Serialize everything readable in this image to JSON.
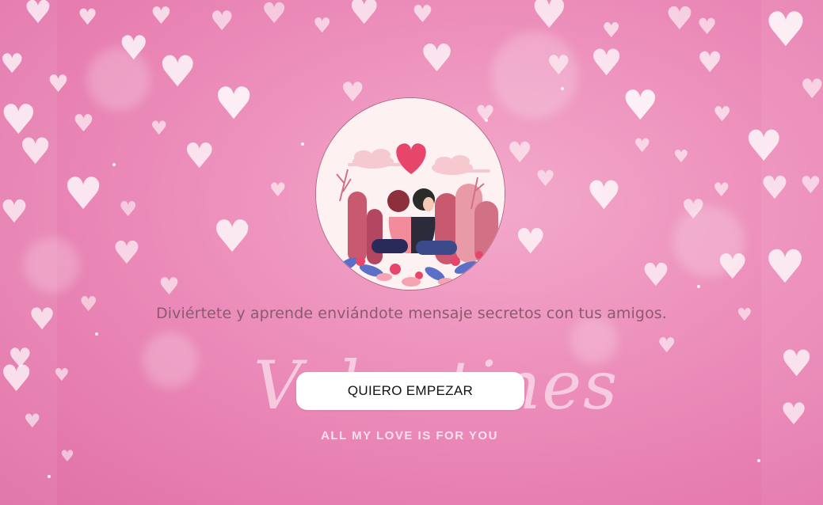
{
  "main": {
    "tagline": "Diviértete y aprende enviándote mensaje secretos con tus amigos.",
    "start_button_label": "QUIERO EMPEZAR"
  },
  "background": {
    "script_word": "Valentines",
    "slogan": "ALL MY LOVE IS FOR YOU",
    "heart_glyph": "♥"
  },
  "colors": {
    "background_pink": "#ec8dba",
    "tagline_text": "#8b5a6e",
    "button_bg": "#ffffff",
    "button_text": "#111111",
    "illustration_heart": "#e8456b"
  },
  "icons": {
    "background_hearts": "heart-icon",
    "illustration": "couple-illustration"
  }
}
